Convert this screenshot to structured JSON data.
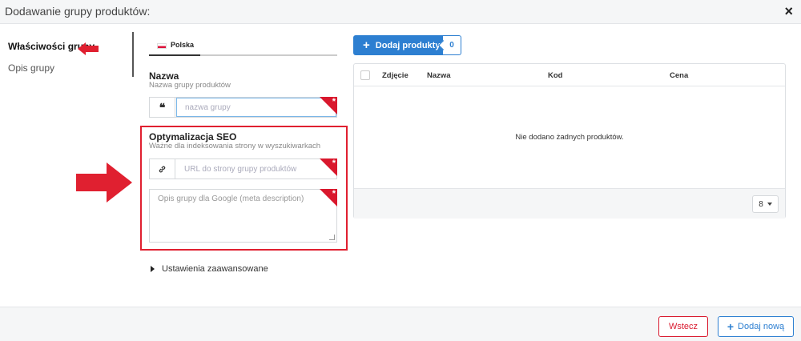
{
  "modal": {
    "title": "Dodawanie grupy produktów:",
    "close_icon": "×"
  },
  "sidebar": {
    "items": [
      {
        "label": "Właściwości grupy",
        "active": true
      },
      {
        "label": "Opis grupy",
        "active": false
      }
    ]
  },
  "language_tab": {
    "label": "Polska",
    "flag": "poland-flag"
  },
  "name_field": {
    "label": "Nazwa",
    "hint": "Nazwa grupy produktów",
    "addon_icon": "quote-icon",
    "addon_glyph": "❝",
    "placeholder": "nazwa grupy",
    "value": "",
    "required_mark": "*"
  },
  "seo": {
    "title": "Optymalizacja SEO",
    "hint": "Ważne dla indeksowania strony w wyszukiwarkach",
    "url_field": {
      "addon_icon": "link-icon",
      "placeholder": "URL do strony grupy produktów",
      "value": "",
      "required_mark": "*"
    },
    "description_field": {
      "placeholder": "Opis grupy dla Google (meta description)",
      "value": "",
      "required_mark": "*"
    }
  },
  "advanced_settings": {
    "label": "Ustawienia zaawansowane"
  },
  "products": {
    "add_button": {
      "label": "Dodaj produkty",
      "count": "0"
    },
    "columns": [
      "Zdjęcie",
      "Nazwa",
      "Kod",
      "Cena"
    ],
    "empty_message": "Nie dodano żadnych produktów.",
    "per_page": "8"
  },
  "footer": {
    "back_label": "Wstecz",
    "add_new_label": "Dodaj nową"
  },
  "colors": {
    "accent_blue": "#2d7fd1",
    "required_red": "#d9182d",
    "annotation_red": "#e02030"
  }
}
